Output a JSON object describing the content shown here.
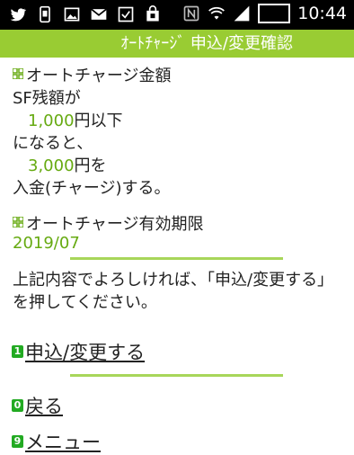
{
  "statusbar": {
    "left_icons": [
      "twitter-icon",
      "phone-icon",
      "image-icon",
      "gmail-icon",
      "checkbox-icon",
      "shopping-bag-icon"
    ],
    "battery": "49%",
    "time": "10:44"
  },
  "header": {
    "title": "ｵｰﾄﾁｬｰｼﾞ 申込/変更確認"
  },
  "section1": {
    "heading": "オートチャージ金額",
    "line1": "SF残額が",
    "amount1": "1,000",
    "suffix1": "円以下",
    "line2": "になると、",
    "amount2": "3,000",
    "suffix2": "円を",
    "line3": "入金(チャージ)する。"
  },
  "section2": {
    "heading": "オートチャージ有効期限",
    "value": "2019/07"
  },
  "confirm": {
    "line1": "上記内容でよろしければ、「申込/変更する」",
    "line2": "を押してください。"
  },
  "actions": {
    "submit_key": "1",
    "submit_label": "申込/変更する",
    "back_key": "0",
    "back_label": "戻る",
    "menu_key": "9",
    "menu_label": "メニュー"
  },
  "colors": {
    "header_bg": "#99cc33",
    "accent_green": "#66aa11",
    "key_green": "#22aa22"
  }
}
